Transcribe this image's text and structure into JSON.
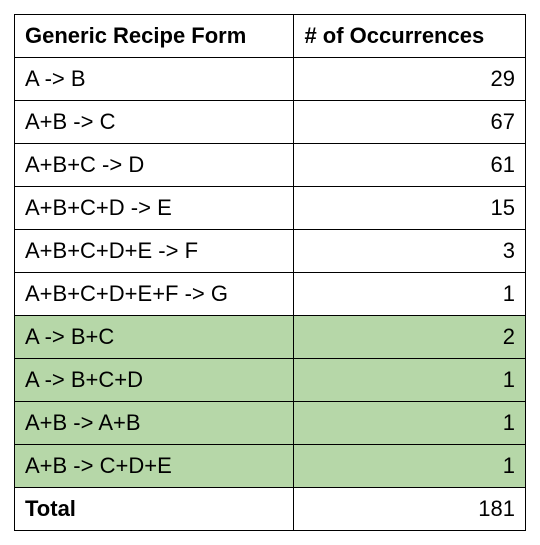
{
  "chart_data": {
    "type": "table",
    "title": "",
    "columns": [
      "Generic Recipe Form",
      "# of Occurrences"
    ],
    "rows": [
      {
        "form": "A -> B",
        "count": 29,
        "highlight": false
      },
      {
        "form": "A+B -> C",
        "count": 67,
        "highlight": false
      },
      {
        "form": "A+B+C -> D",
        "count": 61,
        "highlight": false
      },
      {
        "form": "A+B+C+D -> E",
        "count": 15,
        "highlight": false
      },
      {
        "form": "A+B+C+D+E -> F",
        "count": 3,
        "highlight": false
      },
      {
        "form": "A+B+C+D+E+F -> G",
        "count": 1,
        "highlight": false
      },
      {
        "form": "A -> B+C",
        "count": 2,
        "highlight": true
      },
      {
        "form": "A -> B+C+D",
        "count": 1,
        "highlight": true
      },
      {
        "form": "A+B -> A+B",
        "count": 1,
        "highlight": true
      },
      {
        "form": "A+B -> C+D+E",
        "count": 1,
        "highlight": true
      }
    ],
    "total_label": "Total",
    "total_value": 181
  }
}
